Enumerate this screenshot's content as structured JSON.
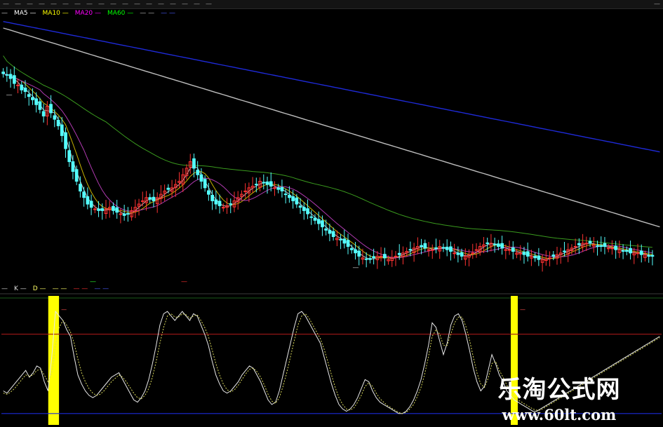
{
  "toolbar": {
    "items": [
      "—",
      "—",
      "—",
      "—",
      "—",
      "—",
      "—",
      "—",
      "—",
      "—",
      "—",
      "—",
      "—",
      "—",
      "—",
      "—",
      "—",
      "—"
    ],
    "right": "—"
  },
  "ma_legend": {
    "title": "—",
    "entries": [
      {
        "label": "MA5",
        "value": "—",
        "color": "#ffffff"
      },
      {
        "label": "MA10",
        "value": "—",
        "color": "#ffff00"
      },
      {
        "label": "MA20",
        "value": "—",
        "color": "#ff00ff"
      },
      {
        "label": "MA60",
        "value": "—",
        "color": "#00ff00"
      },
      {
        "label": "—",
        "value": "—",
        "color": "#bbbbbb"
      },
      {
        "label": "—",
        "value": "—",
        "color": "#4a5bff"
      }
    ]
  },
  "sub_legend": {
    "title": "—",
    "entries": [
      {
        "label": "K",
        "value": "—",
        "color": "#dddddd"
      },
      {
        "label": "D",
        "value": "—",
        "color": "#ffff66"
      },
      {
        "label": "—",
        "value": "—",
        "color": "#ffff66"
      },
      {
        "label": "—",
        "value": "—",
        "color": "#ff3030"
      },
      {
        "label": "—",
        "value": "—",
        "color": "#4a5bff"
      }
    ]
  },
  "annotations": {
    "high_price": "—",
    "low_price": "—",
    "mark_a": "—",
    "mark_b": "—",
    "buy_label_1": "—",
    "buy_label_2": "—"
  },
  "watermark": {
    "line1": "乐淘公式网",
    "line2": "www.60lt.com"
  },
  "colors": {
    "up": "#ff3232",
    "down": "#54ffff",
    "ma_long_blue": "#1e2ad8",
    "ma_white": "#bdbdbd",
    "ma_green": "#3a9a1e",
    "ma_magenta": "#b03ab0",
    "ma_yellow": "#c8b400",
    "k_line": "#e8e8e8",
    "d_line": "#d8d85a",
    "bar_yellow": "#ffff00",
    "line_red": "#a01818",
    "line_blue": "#1a2ad8",
    "divider": "#7a1a1a"
  },
  "chart_data": [
    {
      "type": "candlestick",
      "title": "",
      "xlabel": "",
      "ylabel": "",
      "n_bars": 180,
      "candles_close": [
        18.9,
        18.85,
        18.75,
        18.6,
        18.55,
        18.4,
        18.35,
        18.2,
        18.1,
        17.95,
        17.8,
        17.6,
        17.9,
        17.7,
        17.5,
        17.3,
        17.0,
        16.6,
        16.2,
        15.9,
        15.6,
        15.3,
        15.1,
        14.9,
        14.8,
        14.75,
        14.7,
        14.7,
        14.75,
        14.8,
        14.7,
        14.65,
        14.6,
        14.55,
        14.6,
        14.7,
        14.8,
        14.9,
        15.0,
        15.1,
        15.05,
        15.0,
        15.1,
        15.2,
        15.3,
        15.35,
        15.4,
        15.5,
        15.6,
        15.8,
        16.0,
        16.2,
        16.0,
        15.8,
        15.6,
        15.4,
        15.2,
        15.0,
        14.9,
        14.85,
        14.8,
        14.85,
        14.9,
        15.0,
        15.1,
        15.2,
        15.3,
        15.4,
        15.45,
        15.5,
        15.6,
        15.55,
        15.5,
        15.45,
        15.4,
        15.35,
        15.3,
        15.2,
        15.1,
        15.0,
        14.9,
        14.8,
        14.7,
        14.6,
        14.5,
        14.4,
        14.3,
        14.2,
        14.1,
        14.0,
        13.9,
        13.85,
        13.8,
        13.7,
        13.6,
        13.5,
        13.4,
        13.3,
        13.25,
        13.2,
        13.2,
        13.25,
        13.3,
        13.3,
        13.25,
        13.2,
        13.25,
        13.3,
        13.35,
        13.4,
        13.45,
        13.5,
        13.55,
        13.6,
        13.6,
        13.55,
        13.5,
        13.5,
        13.55,
        13.6,
        13.55,
        13.5,
        13.45,
        13.4,
        13.35,
        13.3,
        13.3,
        13.35,
        13.4,
        13.5,
        13.6,
        13.65,
        13.7,
        13.7,
        13.65,
        13.6,
        13.55,
        13.5,
        13.5,
        13.45,
        13.4,
        13.4,
        13.35,
        13.3,
        13.3,
        13.25,
        13.2,
        13.2,
        13.2,
        13.25,
        13.3,
        13.35,
        13.4,
        13.45,
        13.5,
        13.55,
        13.6,
        13.65,
        13.7,
        13.7,
        13.7,
        13.65,
        13.6,
        13.6,
        13.6,
        13.55,
        13.55,
        13.5,
        13.5,
        13.45,
        13.45,
        13.4,
        13.4,
        13.4,
        13.35,
        13.35,
        13.3,
        13.3
      ],
      "ylim": [
        12.6,
        20.6
      ],
      "ma_series": [
        {
          "name": "MA5",
          "start": 18.9,
          "end": 13.3
        },
        {
          "name": "MA10",
          "start": 19.0,
          "end": 13.4
        },
        {
          "name": "MA20",
          "start": 19.4,
          "end": 13.5
        },
        {
          "name": "MA60",
          "start": 19.9,
          "end": 13.6
        },
        {
          "name": "—",
          "start": 20.3,
          "end": 14.2
        },
        {
          "name": "—",
          "start": 20.5,
          "end": 16.5
        }
      ]
    },
    {
      "type": "line",
      "title": "",
      "xlabel": "",
      "ylabel": "",
      "ylim": [
        0,
        110
      ],
      "levels": [
        {
          "name": "—",
          "value": 80,
          "color": "#a01818"
        },
        {
          "name": "—",
          "value": 10,
          "color": "#1a2ad8"
        }
      ],
      "series": [
        {
          "name": "K",
          "values": [
            30,
            28,
            32,
            36,
            40,
            44,
            48,
            42,
            46,
            52,
            50,
            38,
            30,
            60,
            100,
            96,
            92,
            84,
            78,
            60,
            44,
            36,
            30,
            26,
            24,
            26,
            30,
            34,
            38,
            42,
            44,
            46,
            40,
            34,
            28,
            22,
            20,
            24,
            30,
            40,
            54,
            70,
            88,
            98,
            100,
            96,
            92,
            96,
            100,
            96,
            92,
            98,
            96,
            88,
            80,
            70,
            56,
            44,
            36,
            30,
            28,
            30,
            34,
            38,
            44,
            48,
            52,
            50,
            44,
            38,
            30,
            22,
            18,
            20,
            30,
            44,
            58,
            72,
            86,
            98,
            100,
            96,
            90,
            84,
            78,
            72,
            60,
            48,
            36,
            26,
            18,
            14,
            12,
            14,
            18,
            24,
            32,
            40,
            38,
            30,
            24,
            20,
            18,
            16,
            14,
            12,
            10,
            10,
            12,
            16,
            22,
            30,
            40,
            54,
            70,
            90,
            86,
            74,
            62,
            72,
            88,
            96,
            98,
            92,
            80,
            66,
            50,
            38,
            30,
            34,
            48,
            62,
            54,
            44,
            38,
            30,
            26,
            22,
            20,
            18,
            16,
            14,
            12,
            12,
            14,
            16,
            18,
            20,
            22,
            24,
            26,
            28,
            30,
            32,
            34,
            36,
            38,
            40,
            42,
            44,
            46,
            48,
            50,
            52,
            54,
            56,
            58,
            60,
            62,
            64,
            66,
            68,
            70,
            72,
            74,
            76,
            78
          ]
        },
        {
          "name": "D",
          "values": [
            28,
            27,
            29,
            32,
            36,
            40,
            44,
            43,
            44,
            48,
            49,
            44,
            38,
            46,
            70,
            86,
            92,
            88,
            82,
            72,
            58,
            46,
            38,
            32,
            28,
            26,
            27,
            30,
            34,
            38,
            41,
            44,
            42,
            38,
            33,
            28,
            24,
            23,
            26,
            32,
            42,
            56,
            72,
            86,
            96,
            98,
            95,
            95,
            98,
            97,
            94,
            96,
            97,
            92,
            86,
            78,
            66,
            54,
            44,
            36,
            31,
            29,
            31,
            35,
            40,
            45,
            49,
            50,
            47,
            42,
            35,
            27,
            21,
            19,
            24,
            34,
            46,
            60,
            74,
            88,
            96,
            98,
            94,
            88,
            82,
            76,
            67,
            56,
            44,
            33,
            24,
            18,
            14,
            13,
            15,
            20,
            26,
            34,
            37,
            34,
            28,
            23,
            20,
            17,
            15,
            13,
            11,
            10,
            11,
            14,
            18,
            25,
            33,
            45,
            60,
            78,
            84,
            80,
            70,
            70,
            80,
            90,
            95,
            95,
            87,
            75,
            60,
            46,
            36,
            33,
            41,
            54,
            56,
            48,
            42,
            35,
            30,
            25,
            22,
            20,
            18,
            16,
            14,
            13,
            13,
            15,
            17,
            19,
            21,
            23,
            25,
            27,
            29,
            31,
            33,
            35,
            37,
            39,
            41,
            43,
            45,
            47,
            49,
            51,
            53,
            55,
            57,
            59,
            61,
            63,
            65,
            67,
            69,
            71,
            73,
            75,
            77
          ]
        }
      ],
      "signal_bars": [
        13,
        14,
        137
      ]
    }
  ]
}
